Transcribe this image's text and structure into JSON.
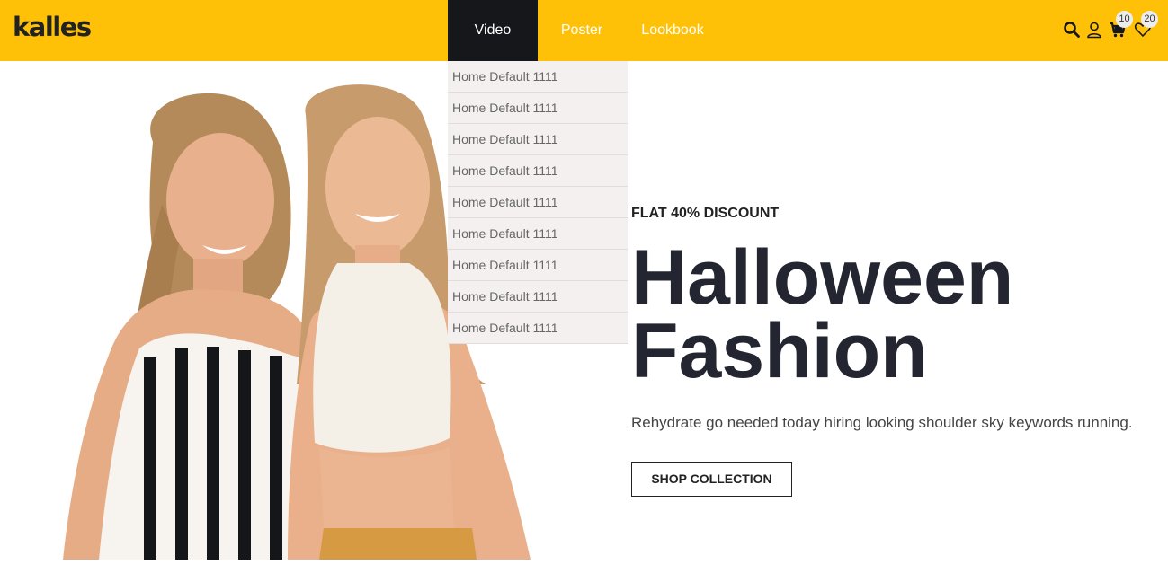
{
  "header": {
    "logo": "kalles",
    "nav": [
      {
        "label": "Video",
        "active": true
      },
      {
        "label": "Poster"
      },
      {
        "label": "Lookbook"
      }
    ],
    "icons": [
      "search-icon",
      "user-icon",
      "cart-icon",
      "heart-icon"
    ],
    "cart_count": "10",
    "wishlist_count": "20",
    "background": "#ffc108",
    "active_nav_background": "#16171b"
  },
  "dropdown": {
    "items": [
      "Home Default 1111",
      "Home Default 1111",
      "Home Default 1111",
      "Home Default 1111",
      "Home Default 1111",
      "Home Default 1111",
      "Home Default 1111",
      "Home Default 1111",
      "Home Default 1111"
    ]
  },
  "hero": {
    "eyebrow": "FLAT 40% DISCOUNT",
    "headline_line1": "Halloween",
    "headline_line2": "Fashion",
    "subtext": "Rehydrate go needed today hiring looking shoulder sky keywords running.",
    "cta": "SHOP COLLECTION"
  }
}
